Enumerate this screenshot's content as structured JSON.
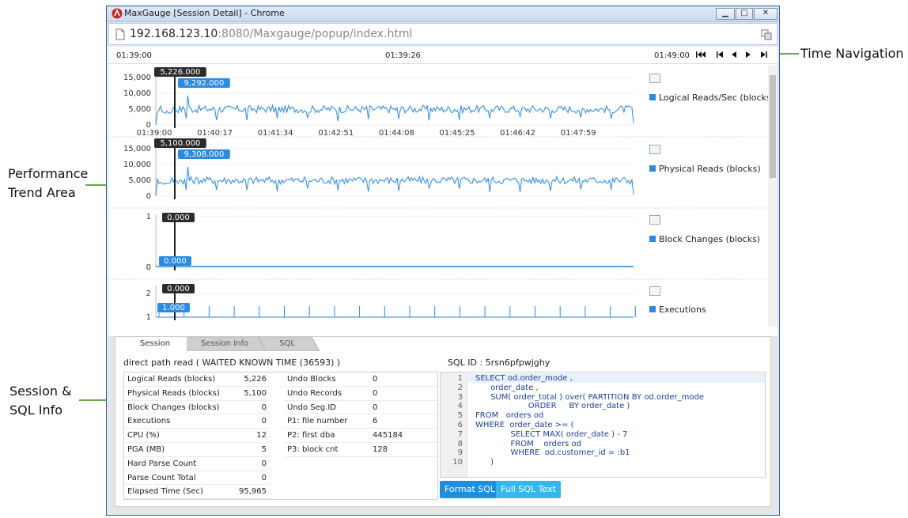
{
  "callouts": {
    "time_nav": "Time Navigation",
    "perf_trend_1": "Performance",
    "perf_trend_2": "Trend Area",
    "session_info_1": "Session &",
    "session_info_2": "SQL Info"
  },
  "window": {
    "title": "MaxGauge [Session Detail] - Chrome",
    "url_host": "192.168.123.10",
    "url_rest": ":8080/Maxgauge/popup/index.html",
    "controls": {
      "minimize": "▁",
      "maximize": "□",
      "close": "✕"
    }
  },
  "timebar": {
    "start": "01:39:00",
    "current": "01:39:26",
    "end": "01:49:00",
    "nav_buttons": [
      "first",
      "step-back",
      "prev",
      "next",
      "last"
    ]
  },
  "charts": [
    {
      "series": "Logical Reads/Sec (blocks)",
      "yticks": [
        "15,000",
        "10,000",
        "5,000",
        "0"
      ],
      "ymax": 15000,
      "cursor_value": "5,226.000",
      "peak_value": "9,292.000",
      "xticks": [
        "01:39:00",
        "01:40:17",
        "01:41:34",
        "01:42:51",
        "01:44:08",
        "01:45:25",
        "01:46:42",
        "01:47:59"
      ]
    },
    {
      "series": "Physical Reads (blocks)",
      "yticks": [
        "15,000",
        "10,000",
        "5,000",
        "0"
      ],
      "ymax": 15000,
      "cursor_value": "5,100.000",
      "peak_value": "9,308.000"
    },
    {
      "series": "Block Changes (blocks)",
      "yticks": [
        "1",
        "0"
      ],
      "ymax": 1,
      "cursor_value": "0.000",
      "peak_value": "0.000"
    },
    {
      "series": "Executions",
      "yticks": [
        "2",
        "1"
      ],
      "ymax": 2,
      "cursor_value": "0.000",
      "peak_value": "1.000"
    }
  ],
  "tabs": [
    {
      "label": "Session",
      "active": true
    },
    {
      "label": "Session Info",
      "active": false
    },
    {
      "label": "SQL",
      "active": false
    }
  ],
  "session": {
    "wait_event": "direct path read ( WAITED KNOWN TIME (36593) )",
    "sql_id_label": "SQL ID : 5rsn6pfpwjghy",
    "stats_left": [
      {
        "k": "Logical Reads (blocks)",
        "v": "5,226"
      },
      {
        "k": "Physical Reads (blocks)",
        "v": "5,100"
      },
      {
        "k": "Block Changes (blocks)",
        "v": "0"
      },
      {
        "k": "Executions",
        "v": "0"
      },
      {
        "k": "CPU (%)",
        "v": "12"
      },
      {
        "k": "PGA (MB)",
        "v": "5"
      },
      {
        "k": "Hard Parse Count",
        "v": "0"
      },
      {
        "k": "Parse Count Total",
        "v": "0"
      },
      {
        "k": "Elapsed Time (Sec)",
        "v": "95,965"
      }
    ],
    "stats_right": [
      {
        "k": "Undo Blocks",
        "v": "0"
      },
      {
        "k": "Undo Records",
        "v": "0"
      },
      {
        "k": "Undo Seg.ID",
        "v": "0"
      },
      {
        "k": "P1: file number",
        "v": "6"
      },
      {
        "k": "P2: first dba",
        "v": "445184"
      },
      {
        "k": "P3: block cnt",
        "v": "128"
      }
    ]
  },
  "sql": {
    "lines": [
      "SELECT od.order_mode ,",
      "      order_date ,",
      "      SUM( order_total ) over( PARTITION BY od.order_mode",
      "                     ORDER     BY order_date )",
      "FROM   orders od",
      "WHERE  order_date >= (",
      "              SELECT MAX( order_date ) - 7",
      "              FROM    orders od",
      "              WHERE  od.customer_id = :b1",
      "      )"
    ],
    "format_button": "Format SQL",
    "full_text_button": "Full SQL Text"
  }
}
